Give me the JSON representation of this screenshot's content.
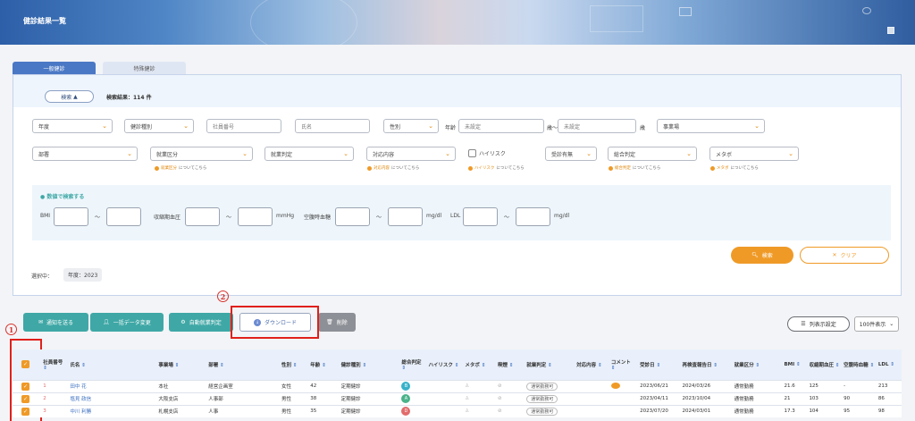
{
  "header": {
    "title": "健診結果一覧"
  },
  "tabs": [
    {
      "label": "一般健診"
    },
    {
      "label": "特殊健診"
    }
  ],
  "search": {
    "toggle_label": "検索",
    "result_count": "検索結果：114 件",
    "row1": {
      "year": "年度",
      "exam_type": "健診種別",
      "employee_no": "社員番号",
      "name": "氏名",
      "gender": "性別",
      "age_label": "年齢",
      "age_from": "未設定",
      "age_sep": "歳〜",
      "age_to": "未設定",
      "age_unit": "歳",
      "office": "事業場"
    },
    "row2": {
      "department": "部署",
      "work_class": "就業区分",
      "work_judgement": "就業判定",
      "response": "対応内容",
      "high_risk": "ハイリスク",
      "attended": "受診有無",
      "overall": "総合判定",
      "metabo": "メタボ"
    },
    "hints": {
      "work_class_hl": "就業区分",
      "response_hl": "対応内容",
      "high_risk_hl": "ハイリスク",
      "overall_hl": "総合判定",
      "metabo_hl": "メタボ",
      "suffix": "についてこちら"
    },
    "numeric": {
      "title": "● 数値で検索する",
      "bmi": "BMI",
      "sbp": "収縮期血圧",
      "sbp_unit": "mmHg",
      "glucose": "空腹時血糖",
      "glucose_unit": "mg/dl",
      "ldl": "LDL",
      "ldl_unit": "mg/dl",
      "tilde": "〜"
    },
    "search_button": "検索",
    "clear_button": "クリア",
    "selected_label": "選択中：",
    "selected_value": "年度：2023"
  },
  "toolbar": {
    "notify": "通知を送る",
    "bulk_change": "一括データ変更",
    "auto_judge": "自動就業判定",
    "download": "ダウンロード",
    "delete": "削除",
    "columns": "列表示設定",
    "per_page": "100件表示"
  },
  "annotations": {
    "one": "1",
    "two": "2"
  },
  "table": {
    "headers": {
      "emp_no": "社員番号",
      "name": "氏名",
      "office": "事業場",
      "dept": "部署",
      "gender": "性別",
      "age": "年齢",
      "exam_type": "健診種別",
      "overall": "総合判定",
      "high_risk": "ハイリスク",
      "metabo": "メタボ",
      "smoking": "喫煙",
      "work_judge": "就業判定",
      "response": "対応内容",
      "comment": "コメント",
      "exam_date": "受診日",
      "reexam_date": "再検査報告日",
      "work_class": "就業区分",
      "bmi": "BMI",
      "sbp": "収縮期血圧",
      "glucose": "空腹時血糖",
      "ldl": "LDL"
    },
    "rows": [
      {
        "no": "1",
        "name": "田中 花",
        "office": "本社",
        "dept": "経営企画室",
        "gender": "女性",
        "age": "42",
        "exam_type": "定期健診",
        "grade": "B",
        "grade_color": "#38b1c9",
        "work_judge": "通常勤務可",
        "comment": true,
        "exam_date": "2023/06/21",
        "reexam": "2024/03/26",
        "work_class": "通常勤務",
        "bmi": "21.6",
        "sbp": "125",
        "glucose": "-",
        "ldl": "213"
      },
      {
        "no": "2",
        "name": "塩見 政信",
        "office": "大阪支店",
        "dept": "人事部",
        "gender": "男性",
        "age": "38",
        "exam_type": "定期健診",
        "grade": "A",
        "grade_color": "#4ab38a",
        "work_judge": "通常勤務可",
        "comment": false,
        "exam_date": "2023/04/11",
        "reexam": "2023/10/04",
        "work_class": "通常勤務",
        "bmi": "21",
        "sbp": "103",
        "glucose": "90",
        "ldl": "86"
      },
      {
        "no": "3",
        "name": "中川 利勝",
        "office": "札幌支店",
        "dept": "人事",
        "gender": "男性",
        "age": "35",
        "exam_type": "定期健診",
        "grade": "D",
        "grade_color": "#e26b6b",
        "work_judge": "通常勤務可",
        "comment": false,
        "exam_date": "2023/07/20",
        "reexam": "2024/03/01",
        "work_class": "通常勤務",
        "bmi": "17.3",
        "sbp": "104",
        "glucose": "95",
        "ldl": "98"
      }
    ]
  }
}
